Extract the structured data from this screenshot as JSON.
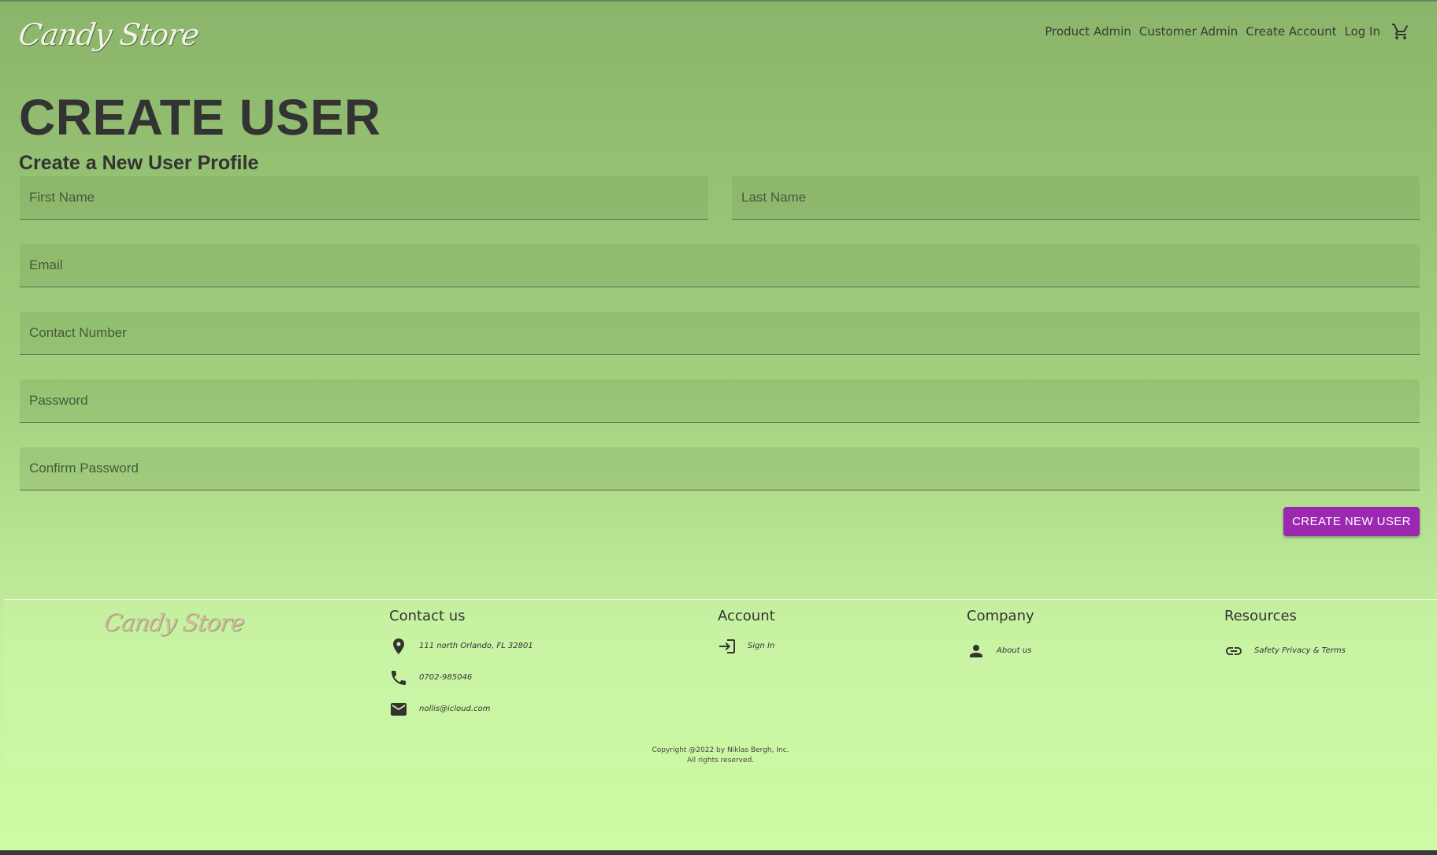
{
  "brand": {
    "logo": "Candy Store"
  },
  "nav": {
    "items": [
      "Product Admin",
      "Customer Admin",
      "Create Account",
      "Log In"
    ],
    "cart_icon": "shopping-cart-icon"
  },
  "page": {
    "title": "CREATE USER",
    "subtitle": "Create a New User Profile"
  },
  "form": {
    "first_name": {
      "placeholder": "First Name",
      "value": ""
    },
    "last_name": {
      "placeholder": "Last Name",
      "value": ""
    },
    "email": {
      "placeholder": "Email",
      "value": ""
    },
    "contact": {
      "placeholder": "Contact Number",
      "value": ""
    },
    "password": {
      "placeholder": "Password",
      "value": ""
    },
    "confirm_password": {
      "placeholder": "Confirm Password",
      "value": ""
    },
    "submit_label": "CREATE NEW USER"
  },
  "footer": {
    "logo": "Candy Store",
    "contact": {
      "heading": "Contact us",
      "address": "111 north Orlando, FL 32801",
      "phone": "0702-985046",
      "email": "nollis@icloud.com"
    },
    "account": {
      "heading": "Account",
      "sign_in": "Sign In"
    },
    "company": {
      "heading": "Company",
      "about": "About us"
    },
    "resources": {
      "heading": "Resources",
      "terms": "Safety Privacy & Terms"
    },
    "copyright_line1": "Copyright @2022 by Niklas Bergh, Inc.",
    "copyright_line2": "All rights reserved."
  },
  "colors": {
    "accent": "#9c27b0",
    "text": "#333333"
  }
}
